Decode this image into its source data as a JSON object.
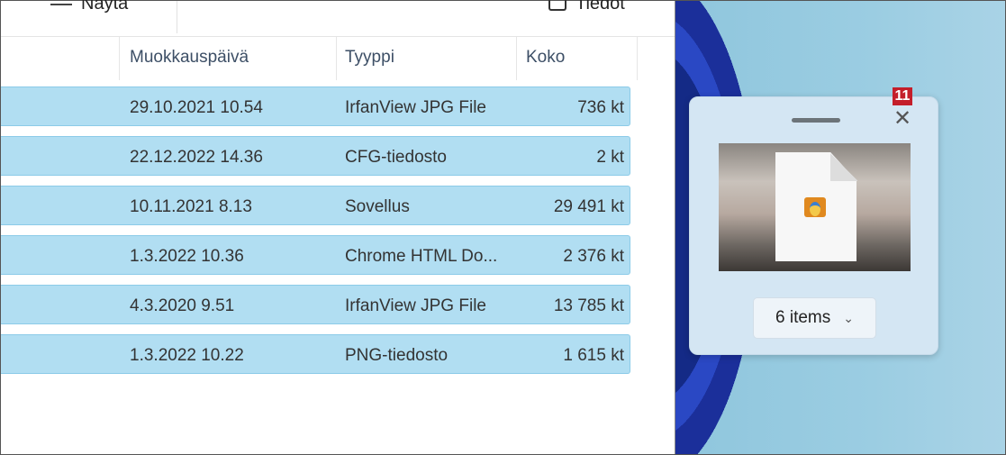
{
  "toolbar": {
    "view_label": "Näytä",
    "details_label": "Tiedot"
  },
  "columns": {
    "modified": "Muokkauspäivä",
    "type": "Tyyppi",
    "size": "Koko"
  },
  "rows": [
    {
      "date": "29.10.2021 10.54",
      "type": "IrfanView JPG File",
      "size": "736 kt"
    },
    {
      "date": "22.12.2022 14.36",
      "type": "CFG-tiedosto",
      "size": "2 kt"
    },
    {
      "date": "10.11.2021 8.13",
      "type": "Sovellus",
      "size": "29 491 kt"
    },
    {
      "date": "1.3.2022 10.36",
      "type": "Chrome HTML Do...",
      "size": "2 376 kt"
    },
    {
      "date": "4.3.2020 9.51",
      "type": "IrfanView JPG File",
      "size": "13 785 kt"
    },
    {
      "date": "1.3.2022 10.22",
      "type": "PNG-tiedosto",
      "size": "1 615 kt"
    }
  ],
  "drag_panel": {
    "badge": "11",
    "close": "✕",
    "items_label": "6 items",
    "chevron": "⌄"
  },
  "colors": {
    "selection": "#b1def2",
    "badge": "#c41e2a"
  }
}
